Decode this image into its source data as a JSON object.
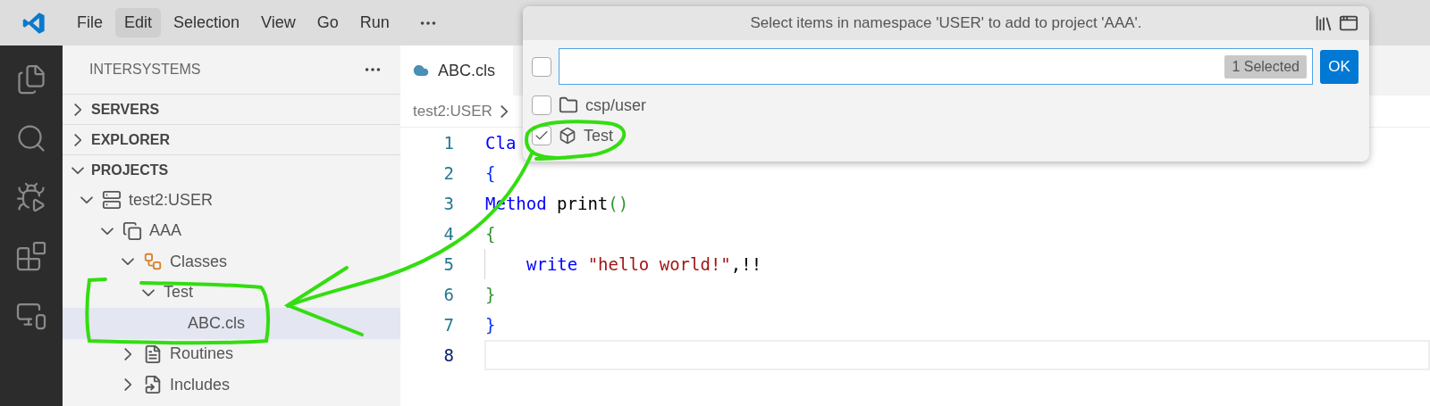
{
  "menu": [
    {
      "label": "File",
      "selected": false
    },
    {
      "label": "Edit",
      "selected": true
    },
    {
      "label": "Selection",
      "selected": false
    },
    {
      "label": "View",
      "selected": false
    },
    {
      "label": "Go",
      "selected": false
    },
    {
      "label": "Run",
      "selected": false
    }
  ],
  "sidebar": {
    "title": "INTERSYSTEMS",
    "sections": [
      {
        "label": "SERVERS",
        "expanded": false
      },
      {
        "label": "EXPLORER",
        "expanded": false
      },
      {
        "label": "PROJECTS",
        "expanded": true
      }
    ],
    "tree": [
      {
        "label": "test2:USER",
        "kind": "server",
        "expanded": true,
        "selected": false,
        "children": [
          {
            "label": "AAA",
            "kind": "project",
            "expanded": true,
            "selected": false,
            "children": [
              {
                "label": "Classes",
                "kind": "classes",
                "expanded": true,
                "selected": false,
                "children": [
                  {
                    "label": "Test",
                    "expanded": true,
                    "selected": false,
                    "children": [
                      {
                        "label": "ABC.cls",
                        "selected": true
                      }
                    ]
                  }
                ]
              },
              {
                "label": "Routines",
                "kind": "routines",
                "expanded": false,
                "selected": false
              },
              {
                "label": "Includes",
                "kind": "includes",
                "expanded": false,
                "selected": false
              }
            ]
          }
        ]
      }
    ]
  },
  "editor": {
    "tab": "ABC.cls",
    "breadcrumb": "test2:USER",
    "lines": [
      {
        "number": "1",
        "current": false,
        "tokens": [
          {
            "kind": "keyword",
            "text": "Cla"
          }
        ]
      },
      {
        "number": "2",
        "current": false,
        "tokens": [
          {
            "kind": "brace1",
            "text": "{"
          }
        ]
      },
      {
        "number": "3",
        "current": false,
        "tokens": [
          {
            "kind": "keyword",
            "text": "Method"
          },
          {
            "kind": "plain",
            "text": " print"
          },
          {
            "kind": "brace2",
            "text": "()"
          }
        ]
      },
      {
        "number": "4",
        "current": false,
        "tokens": [
          {
            "kind": "brace2",
            "text": "{"
          }
        ]
      },
      {
        "number": "5",
        "current": false,
        "indented": true,
        "tokens": [
          {
            "kind": "keyword",
            "text": "write"
          },
          {
            "kind": "string",
            "text": " \"hello world!\""
          },
          {
            "kind": "plain",
            "text": ",!!"
          }
        ]
      },
      {
        "number": "6",
        "current": false,
        "tokens": [
          {
            "kind": "brace2",
            "text": "}"
          }
        ]
      },
      {
        "number": "7",
        "current": false,
        "tokens": [
          {
            "kind": "brace1",
            "text": "}"
          }
        ]
      },
      {
        "number": "8",
        "current": true
      }
    ]
  },
  "popup": {
    "title": "Select items in namespace 'USER' to add to project 'AAA'.",
    "select_all_checked": false,
    "badge": "1 Selected",
    "ok": "OK",
    "items": [
      {
        "label": "csp/user",
        "kind": "folder",
        "checked": false
      },
      {
        "label": "Test",
        "kind": "class",
        "checked": true
      }
    ]
  }
}
